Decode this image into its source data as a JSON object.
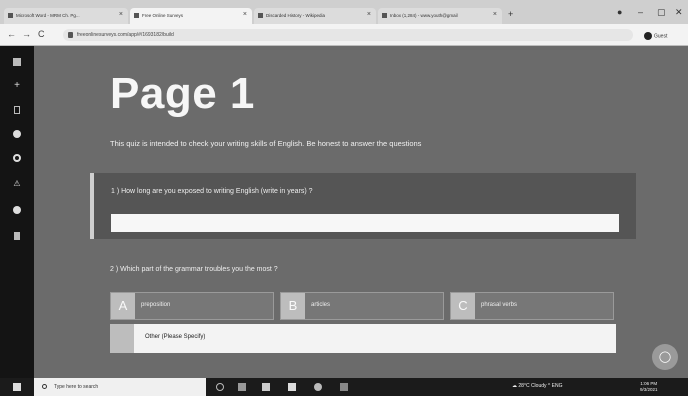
{
  "browser": {
    "tabs": [
      {
        "title": "Microsoft Word - MRM Ch. Pg...",
        "active": false
      },
      {
        "title": "Free Online Surveys",
        "active": true
      },
      {
        "title": "Discarded History - Wikipedia",
        "active": false
      },
      {
        "title": "Inbox (1,284) - www.youth@gmail",
        "active": false
      }
    ],
    "new_tab_label": "+",
    "window_controls": {
      "menu": "●",
      "minimize": "–",
      "maximize": "▢",
      "close": "✕"
    },
    "nav": {
      "back": "←",
      "forward": "→",
      "reload": "C"
    },
    "url": "freeonlinesurveys.com/app/#/1693182/build",
    "profile_label": "Guest"
  },
  "sidebar": {
    "icons": [
      "grid-icon",
      "plus-icon",
      "page-icon",
      "paint-icon",
      "gear-icon",
      "warning-icon",
      "user-icon",
      "trash-icon"
    ]
  },
  "survey": {
    "title": "Page 1",
    "description": "This quiz is intended to check your writing skills of English. Be honest to answer the questions",
    "q1": {
      "label": "1 )  How long are you exposed to writing English (write in years) ?",
      "value": ""
    },
    "q2": {
      "label": "2 )  Which part of the grammar troubles you the most ?",
      "options": [
        {
          "key": "A",
          "text": "preposition"
        },
        {
          "key": "B",
          "text": "articles"
        },
        {
          "key": "C",
          "text": "phrasal verbs"
        }
      ],
      "other_label": "Other (Please Specify)"
    },
    "chat_icon": "chat-icon"
  },
  "taskbar": {
    "search_placeholder": "Type here to search",
    "tray": "☁ 28°C  Cloudy  ^  ENG",
    "time": "1:06 PM",
    "date": "9/3/2021"
  }
}
